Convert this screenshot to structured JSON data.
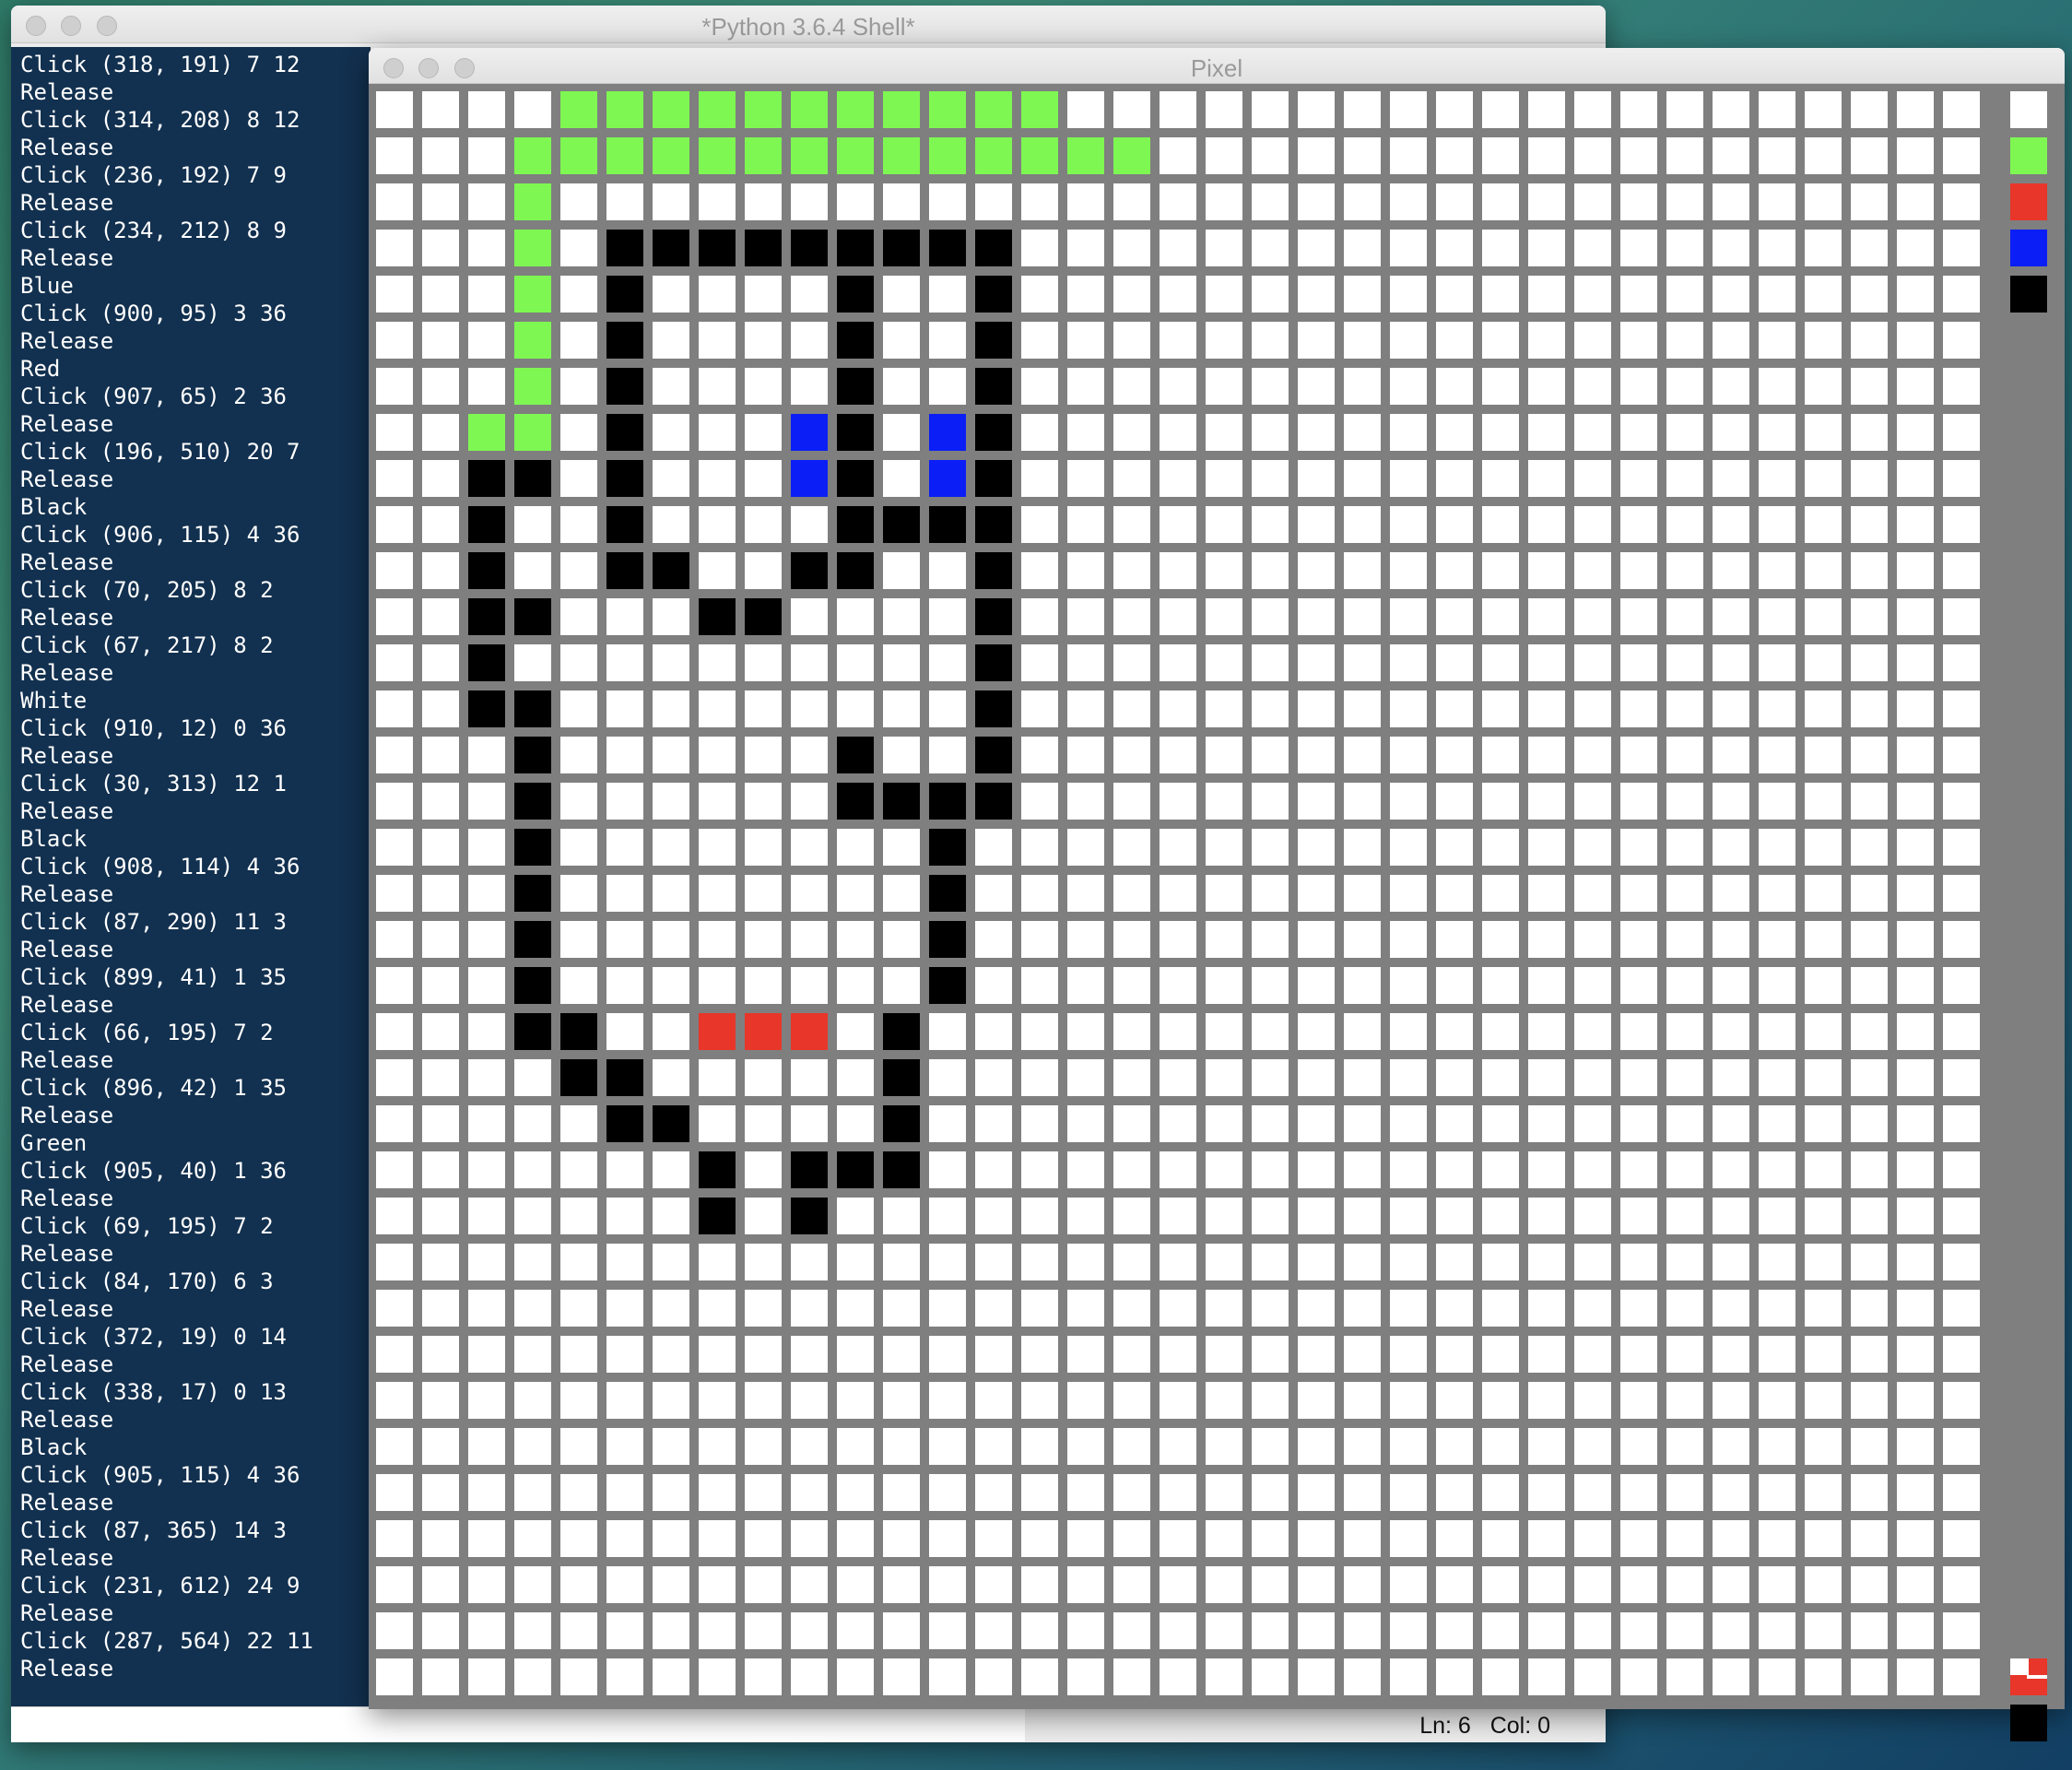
{
  "shell": {
    "title": "*Python 3.6.4 Shell*",
    "lines": [
      "Click (318, 191) 7 12",
      "Release",
      "Click (314, 208) 8 12",
      "Release",
      "Click (236, 192) 7 9",
      "Release",
      "Click (234, 212) 8 9",
      "Release",
      "Blue",
      "Click (900, 95) 3 36",
      "Release",
      "Red",
      "Click (907, 65) 2 36",
      "Release",
      "Click (196, 510) 20 7",
      "Release",
      "Black",
      "Click (906, 115) 4 36",
      "Release",
      "Click (70, 205) 8 2",
      "Release",
      "Click (67, 217) 8 2",
      "Release",
      "White",
      "Click (910, 12) 0 36",
      "Release",
      "Click (30, 313) 12 1",
      "Release",
      "Black",
      "Click (908, 114) 4 36",
      "Release",
      "Click (87, 290) 11 3",
      "Release",
      "Click (899, 41) 1 35",
      "Release",
      "Click (66, 195) 7 2",
      "Release",
      "Click (896, 42) 1 35",
      "Release",
      "Green",
      "Click (905, 40) 1 36",
      "Release",
      "Click (69, 195) 7 2",
      "Release",
      "Click (84, 170) 6 3",
      "Release",
      "Click (372, 19) 0 14",
      "Release",
      "Click (338, 17) 0 13",
      "Release",
      "Black",
      "Click (905, 115) 4 36",
      "Release",
      "Click (87, 365) 14 3",
      "Release",
      "Click (231, 612) 24 9",
      "Release",
      "Click (287, 564) 22 11",
      "Release"
    ],
    "status": {
      "ln": "Ln: 6",
      "col": "Col: 0"
    }
  },
  "pixel_window": {
    "title": "Pixel",
    "grid": {
      "rows": 35,
      "cols": 35,
      "colors": {
        "white": "#ffffff",
        "green": "#7ef752",
        "blue": "#0b1ef5",
        "red": "#e8362a",
        "black": "#000000",
        "border": "#7f7f7f"
      },
      "cells": {
        "green": [
          [
            0,
            4
          ],
          [
            0,
            5
          ],
          [
            0,
            6
          ],
          [
            0,
            7
          ],
          [
            0,
            8
          ],
          [
            0,
            9
          ],
          [
            0,
            10
          ],
          [
            0,
            11
          ],
          [
            0,
            12
          ],
          [
            0,
            13
          ],
          [
            0,
            14
          ],
          [
            1,
            3
          ],
          [
            1,
            4
          ],
          [
            1,
            5
          ],
          [
            1,
            6
          ],
          [
            1,
            7
          ],
          [
            1,
            8
          ],
          [
            1,
            9
          ],
          [
            1,
            10
          ],
          [
            1,
            11
          ],
          [
            1,
            12
          ],
          [
            1,
            13
          ],
          [
            1,
            14
          ],
          [
            1,
            15
          ],
          [
            1,
            16
          ],
          [
            2,
            3
          ],
          [
            3,
            3
          ],
          [
            4,
            3
          ],
          [
            5,
            3
          ],
          [
            6,
            3
          ],
          [
            7,
            2
          ],
          [
            7,
            3
          ]
        ],
        "blue": [
          [
            7,
            9
          ],
          [
            7,
            12
          ],
          [
            8,
            9
          ],
          [
            8,
            12
          ]
        ],
        "red": [
          [
            20,
            7
          ],
          [
            20,
            8
          ],
          [
            20,
            9
          ]
        ],
        "black": [
          [
            3,
            5
          ],
          [
            3,
            6
          ],
          [
            3,
            7
          ],
          [
            3,
            8
          ],
          [
            3,
            9
          ],
          [
            3,
            10
          ],
          [
            3,
            11
          ],
          [
            3,
            12
          ],
          [
            3,
            13
          ],
          [
            4,
            5
          ],
          [
            4,
            10
          ],
          [
            4,
            13
          ],
          [
            5,
            5
          ],
          [
            5,
            10
          ],
          [
            5,
            13
          ],
          [
            6,
            5
          ],
          [
            6,
            10
          ],
          [
            6,
            13
          ],
          [
            7,
            5
          ],
          [
            7,
            10
          ],
          [
            7,
            13
          ],
          [
            8,
            2
          ],
          [
            8,
            3
          ],
          [
            8,
            5
          ],
          [
            8,
            10
          ],
          [
            8,
            13
          ],
          [
            9,
            2
          ],
          [
            9,
            5
          ],
          [
            9,
            10
          ],
          [
            9,
            11
          ],
          [
            9,
            12
          ],
          [
            9,
            13
          ],
          [
            10,
            2
          ],
          [
            10,
            5
          ],
          [
            10,
            6
          ],
          [
            10,
            9
          ],
          [
            10,
            10
          ],
          [
            10,
            13
          ],
          [
            11,
            2
          ],
          [
            11,
            3
          ],
          [
            11,
            7
          ],
          [
            11,
            8
          ],
          [
            11,
            13
          ],
          [
            12,
            2
          ],
          [
            12,
            13
          ],
          [
            13,
            2
          ],
          [
            13,
            3
          ],
          [
            13,
            13
          ],
          [
            14,
            3
          ],
          [
            14,
            10
          ],
          [
            14,
            13
          ],
          [
            15,
            3
          ],
          [
            15,
            10
          ],
          [
            15,
            11
          ],
          [
            15,
            12
          ],
          [
            15,
            13
          ],
          [
            16,
            3
          ],
          [
            16,
            12
          ],
          [
            17,
            3
          ],
          [
            17,
            12
          ],
          [
            18,
            3
          ],
          [
            18,
            12
          ],
          [
            19,
            3
          ],
          [
            19,
            12
          ],
          [
            20,
            3
          ],
          [
            20,
            4
          ],
          [
            20,
            11
          ],
          [
            21,
            4
          ],
          [
            21,
            5
          ],
          [
            21,
            11
          ],
          [
            22,
            5
          ],
          [
            22,
            6
          ],
          [
            22,
            11
          ],
          [
            23,
            7
          ],
          [
            23,
            9
          ],
          [
            23,
            10
          ],
          [
            23,
            11
          ],
          [
            24,
            7
          ],
          [
            24,
            9
          ]
        ]
      }
    },
    "palette": {
      "white": "#ffffff",
      "green": "#7ef752",
      "red": "#e8362a",
      "blue": "#0b1ef5",
      "black": "#000000",
      "current_icon": "current-color-indicator-icon",
      "current_bottom": "#000000"
    }
  }
}
